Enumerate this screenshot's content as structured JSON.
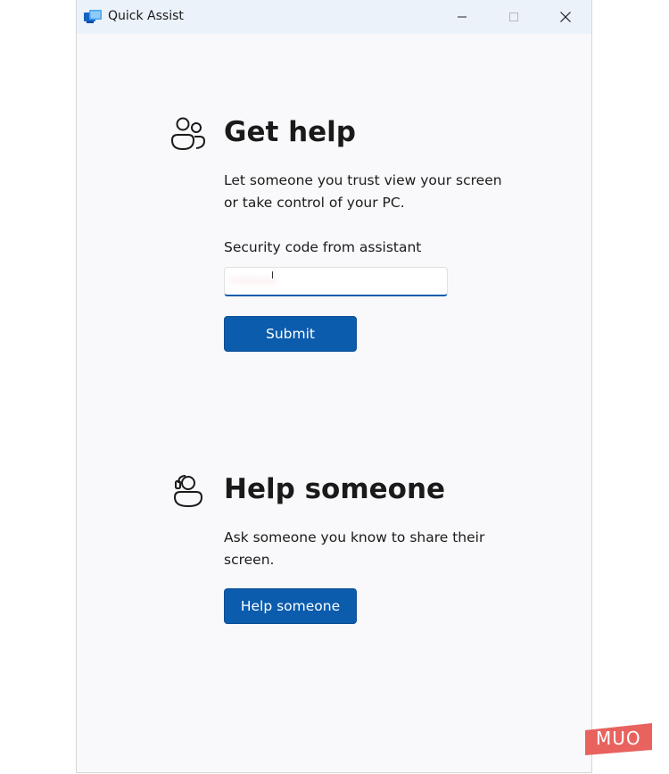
{
  "window": {
    "title": "Quick Assist",
    "app_icon": "monitor-icon",
    "controls": [
      "minimize-icon",
      "maximize-icon",
      "close-icon"
    ]
  },
  "get_help": {
    "icon": "people-icon",
    "heading": "Get help",
    "description": "Let someone you trust view your screen or take control of your PC.",
    "field_label": "Security code from assistant",
    "field_value": "••••••",
    "submit_label": "Submit"
  },
  "help_someone": {
    "icon": "person-headset-icon",
    "heading": "Help someone",
    "description": "Ask someone you know to share their screen.",
    "button_label": "Help someone"
  },
  "watermark": {
    "text": "MUO"
  },
  "colors": {
    "accent": "#0b5cad",
    "titlebar": "#ecf2fa",
    "background": "#f9f9fb",
    "watermark": "#e8635e"
  }
}
